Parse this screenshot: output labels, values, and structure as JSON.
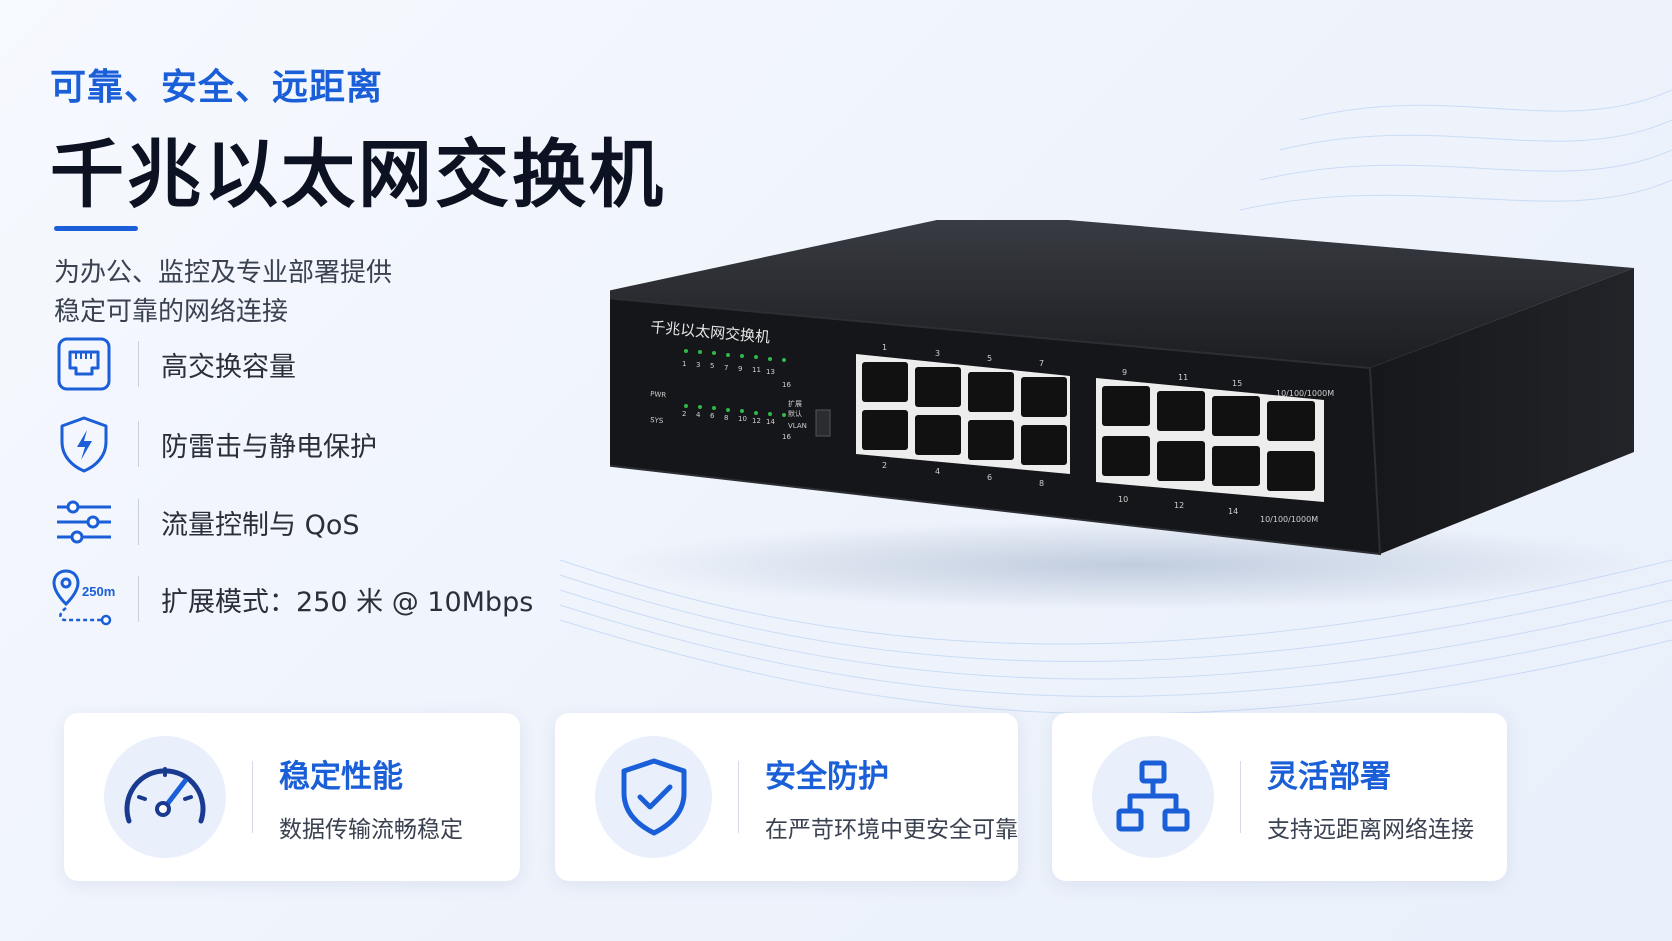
{
  "hero": {
    "tagline": "可靠、安全、远距离",
    "headline": "千兆以太网交换机",
    "intro_line1": "为办公、监控及专业部署提供",
    "intro_line2": "稳定可靠的网络连接"
  },
  "features": [
    {
      "icon": "ethernet-port-icon",
      "label": "高交换容量"
    },
    {
      "icon": "shield-lightning-icon",
      "label": "防雷击与静电保护"
    },
    {
      "icon": "sliders-icon",
      "label": "流量控制与 QoS"
    },
    {
      "icon": "location-pin-icon",
      "label": "扩展模式：250 米 @ 10Mbps",
      "badge": "250m"
    }
  ],
  "cards": [
    {
      "icon": "speedometer-icon",
      "title": "稳定性能",
      "desc": "数据传输流畅稳定"
    },
    {
      "icon": "shield-check-icon",
      "title": "安全防护",
      "desc": "在严苛环境中更安全可靠"
    },
    {
      "icon": "network-topology-icon",
      "title": "灵活部署",
      "desc": "支持远距离网络连接"
    }
  ],
  "device": {
    "label": "千兆以太网交换机",
    "pwr": "PWR",
    "sys": "SYS",
    "led_top": [
      "1",
      "3",
      "5",
      "7",
      "9",
      "11",
      "13",
      "16"
    ],
    "led_bottom": [
      "2",
      "4",
      "6",
      "8",
      "10",
      "12",
      "14",
      "16"
    ],
    "switch_labels": [
      "扩展",
      "默认",
      "VLAN"
    ],
    "ports_top_a": [
      "1",
      "3",
      "5",
      "7"
    ],
    "ports_bottom_a": [
      "2",
      "4",
      "6",
      "8"
    ],
    "ports_top_b": [
      "9",
      "11",
      "15"
    ],
    "ports_bottom_b": [
      "10",
      "12",
      "14"
    ],
    "speed_label": "10/100/1000M"
  },
  "colors": {
    "accent": "#1a5fd8",
    "dark": "#0c1222",
    "card_circle": "#e9f0fc"
  }
}
